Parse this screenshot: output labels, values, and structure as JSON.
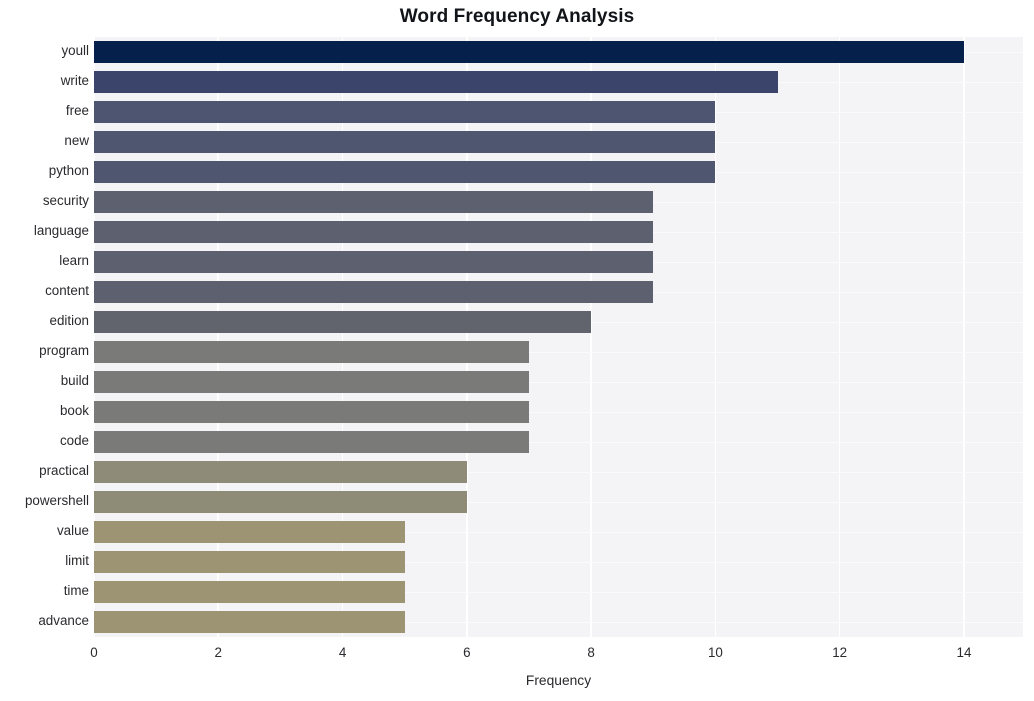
{
  "chart_data": {
    "type": "bar",
    "orientation": "horizontal",
    "title": "Word Frequency Analysis",
    "xlabel": "Frequency",
    "ylabel": "",
    "categories": [
      "youll",
      "write",
      "free",
      "new",
      "python",
      "security",
      "language",
      "learn",
      "content",
      "edition",
      "program",
      "build",
      "book",
      "code",
      "practical",
      "powershell",
      "value",
      "limit",
      "time",
      "advance"
    ],
    "values": [
      14,
      11,
      10,
      10,
      10,
      9,
      9,
      9,
      9,
      8,
      7,
      7,
      7,
      7,
      6,
      6,
      5,
      5,
      5,
      5
    ],
    "bar_colors": [
      "#05214b",
      "#3b456b",
      "#4d5570",
      "#4e5670",
      "#4e5670",
      "#5d606e",
      "#5d606e",
      "#5d606e",
      "#5d606e",
      "#62646d",
      "#7a7a78",
      "#7a7a78",
      "#7a7a78",
      "#7a7a78",
      "#8e8b78",
      "#8e8b77",
      "#9c9472",
      "#9c9472",
      "#9c9472",
      "#9c9472"
    ],
    "xlim": [
      0,
      14.95
    ],
    "xticks": [
      0,
      2,
      4,
      6,
      8,
      10,
      12,
      14
    ],
    "xtick_labels": [
      "0",
      "2",
      "4",
      "6",
      "8",
      "10",
      "12",
      "14"
    ],
    "grid": true,
    "grid_axis": "both",
    "legend": null,
    "plot_background": "#f4f4f6",
    "figure_background": "#ffffff",
    "gridline_color": "#ffffff",
    "title_color": "#111418",
    "tick_label_color": "#2a2a2e"
  }
}
